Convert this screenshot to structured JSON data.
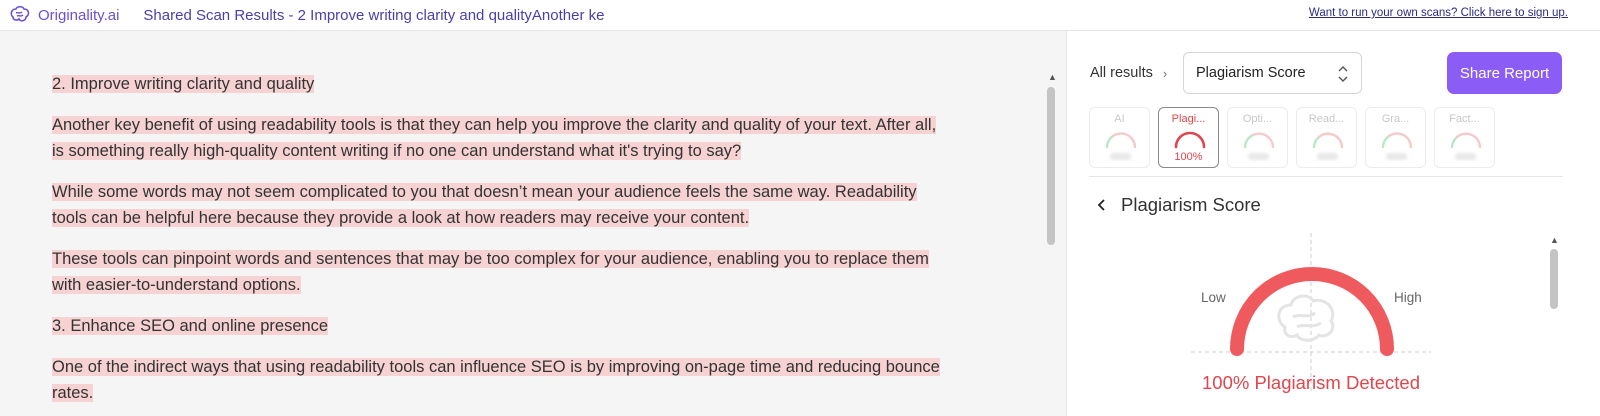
{
  "header": {
    "brand": "Originality.ai",
    "scan_title": "Shared Scan Results - 2 Improve writing clarity and qualityAnother ke",
    "signup_link": "Want to run your own scans? Click here to sign up."
  },
  "document": {
    "paragraphs": [
      "2. Improve writing clarity and quality",
      "Another key benefit of using readability tools is that they can help you improve the clarity and quality of your text. After all, is something really high-quality content writing if no one can understand what it's trying to say?",
      "While some words may not seem complicated to you that doesn’t mean your audience feels the same way. Readability tools can be helpful here because they provide a look at how readers may receive your content.",
      "These tools can pinpoint words and sentences that may be too complex for your audience, enabling you to replace them with easier-to-understand options.",
      "3. Enhance SEO and online presence",
      "One of the indirect ways that using readability tools can influence SEO is by improving on-page time and reducing bounce rates."
    ]
  },
  "panel": {
    "breadcrumb": "All results",
    "select_value": "Plagiarism Score",
    "share_button": "Share Report",
    "tabs": [
      {
        "label": "AI",
        "value": "",
        "active": false
      },
      {
        "label": "Plagi...",
        "value": "100%",
        "active": true
      },
      {
        "label": "Opti...",
        "value": "",
        "active": false
      },
      {
        "label": "Read...",
        "value": "",
        "active": false
      },
      {
        "label": "Gra...",
        "value": "",
        "active": false
      },
      {
        "label": "Fact...",
        "value": "",
        "active": false
      }
    ],
    "section_title": "Plagiarism Score",
    "gauge": {
      "low_label": "Low",
      "high_label": "High",
      "percent": 100,
      "detected_text": "100% Plagiarism Detected"
    }
  },
  "colors": {
    "brand": "#6b4fd8",
    "accent": "#8b5cf6",
    "danger": "#e0464b",
    "highlight": "#f6d2d2",
    "gauge_green": "#7fd4a0",
    "gauge_red": "#f0a0a3"
  }
}
